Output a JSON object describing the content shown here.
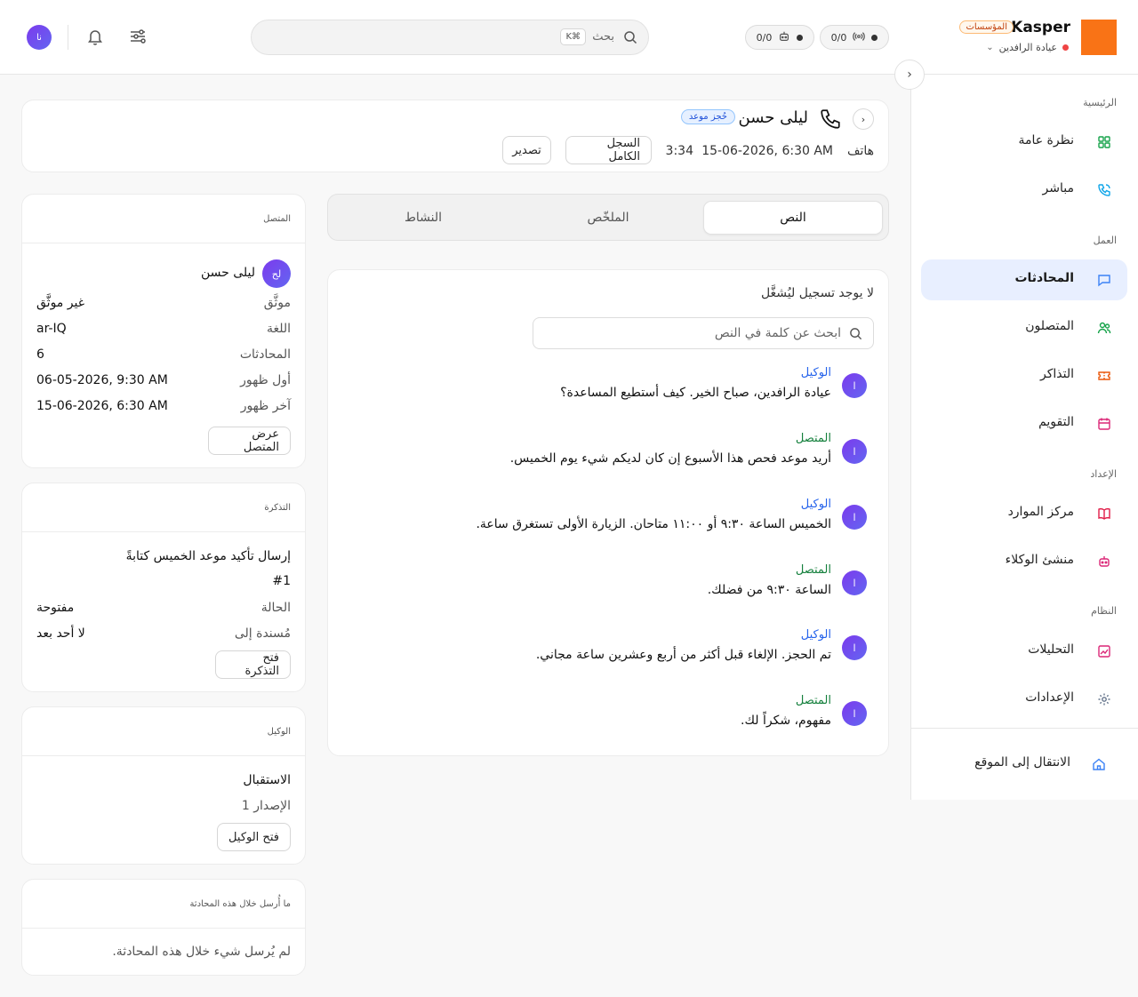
{
  "topbar": {
    "brand": "Kasper",
    "brand_badge": "المؤسسات",
    "org_name": "عيادة الرافدين",
    "pill_calls": "0/0",
    "pill_bots": "0/0",
    "search_placeholder": "بحث",
    "search_shortcut": "⌘K",
    "user_initials": "نا"
  },
  "sidebar": {
    "sections": [
      {
        "label": "الرئيسية",
        "items": [
          {
            "label": "نظرة عامة",
            "icon": "grid-icon"
          },
          {
            "label": "مباشر",
            "icon": "phone-live-icon"
          }
        ]
      },
      {
        "label": "العمل",
        "items": [
          {
            "label": "المحادثات",
            "icon": "chat-icon",
            "active": true
          },
          {
            "label": "المتصلون",
            "icon": "users-icon"
          },
          {
            "label": "التذاكر",
            "icon": "ticket-icon"
          },
          {
            "label": "التقويم",
            "icon": "calendar-icon"
          }
        ]
      },
      {
        "label": "الإعداد",
        "items": [
          {
            "label": "مركز الموارد",
            "icon": "book-icon"
          },
          {
            "label": "منشئ الوكلاء",
            "icon": "bot-icon"
          }
        ]
      },
      {
        "label": "النظام",
        "items": [
          {
            "label": "التحليلات",
            "icon": "chart-icon"
          },
          {
            "label": "الإعدادات",
            "icon": "gear-icon"
          }
        ]
      }
    ],
    "footer_link": "الانتقال إلى الموقع"
  },
  "header": {
    "caller_name": "ليلى حسن",
    "tag": "حُجز موعد",
    "channel": "هاتف",
    "datetime": "15-06-2026, 6:30 AM",
    "duration": "3:34",
    "full_log_label": "السجل الكامل",
    "export_label": "تصدير"
  },
  "tabs": [
    "النص",
    "الملخّص",
    "النشاط"
  ],
  "transcript": {
    "no_recording": "لا يوجد تسجيل ليُشغَّل",
    "search_placeholder": "ابحث عن كلمة في النص",
    "messages": [
      {
        "role": "الوكيل",
        "type": "agent",
        "avatar": "ا",
        "text": "عيادة الرافدين، صباح الخير. كيف أستطيع المساعدة؟"
      },
      {
        "role": "المتصل",
        "type": "caller",
        "avatar": "ا",
        "text": "أريد موعد فحص هذا الأسبوع إن كان لديكم شيء يوم الخميس."
      },
      {
        "role": "الوكيل",
        "type": "agent",
        "avatar": "ا",
        "text": "الخميس الساعة ٩:٣٠ أو ١١:٠٠ متاحان. الزيارة الأولى تستغرق ساعة."
      },
      {
        "role": "المتصل",
        "type": "caller",
        "avatar": "ا",
        "text": "الساعة ٩:٣٠ من فضلك."
      },
      {
        "role": "الوكيل",
        "type": "agent",
        "avatar": "ا",
        "text": "تم الحجز. الإلغاء قبل أكثر من أربع وعشرين ساعة مجاني."
      },
      {
        "role": "المتصل",
        "type": "caller",
        "avatar": "ا",
        "text": "مفهوم، شكراً لك."
      }
    ]
  },
  "caller_card": {
    "title": "المتصل",
    "avatar": "لح",
    "name": "ليلى حسن",
    "rows": [
      {
        "label": "موثَّق",
        "value": "غير موثَّق"
      },
      {
        "label": "اللغة",
        "value": "ar-IQ"
      },
      {
        "label": "المحادثات",
        "value": "6"
      },
      {
        "label": "أول ظهور",
        "value": "06-05-2026, 9:30 AM"
      },
      {
        "label": "آخر ظهور",
        "value": "15-06-2026, 6:30 AM"
      }
    ],
    "button": "عرض المتصل"
  },
  "ticket_card": {
    "title": "التذكرة",
    "subject": "إرسال تأكيد موعد الخميس كتابةً",
    "number": "#1",
    "rows": [
      {
        "label": "الحالة",
        "value": "مفتوحة"
      },
      {
        "label": "مُسندة إلى",
        "value": "لا أحد بعد"
      }
    ],
    "button": "فتح التذكرة"
  },
  "agent_card": {
    "title": "الوكيل",
    "name": "الاستقبال",
    "version": "الإصدار 1",
    "button": "فتح الوكيل"
  },
  "sent_card": {
    "title": "ما أُرسل خلال هذه المحادثة",
    "empty": "لم يُرسل شيء خلال هذه المحادثة."
  }
}
